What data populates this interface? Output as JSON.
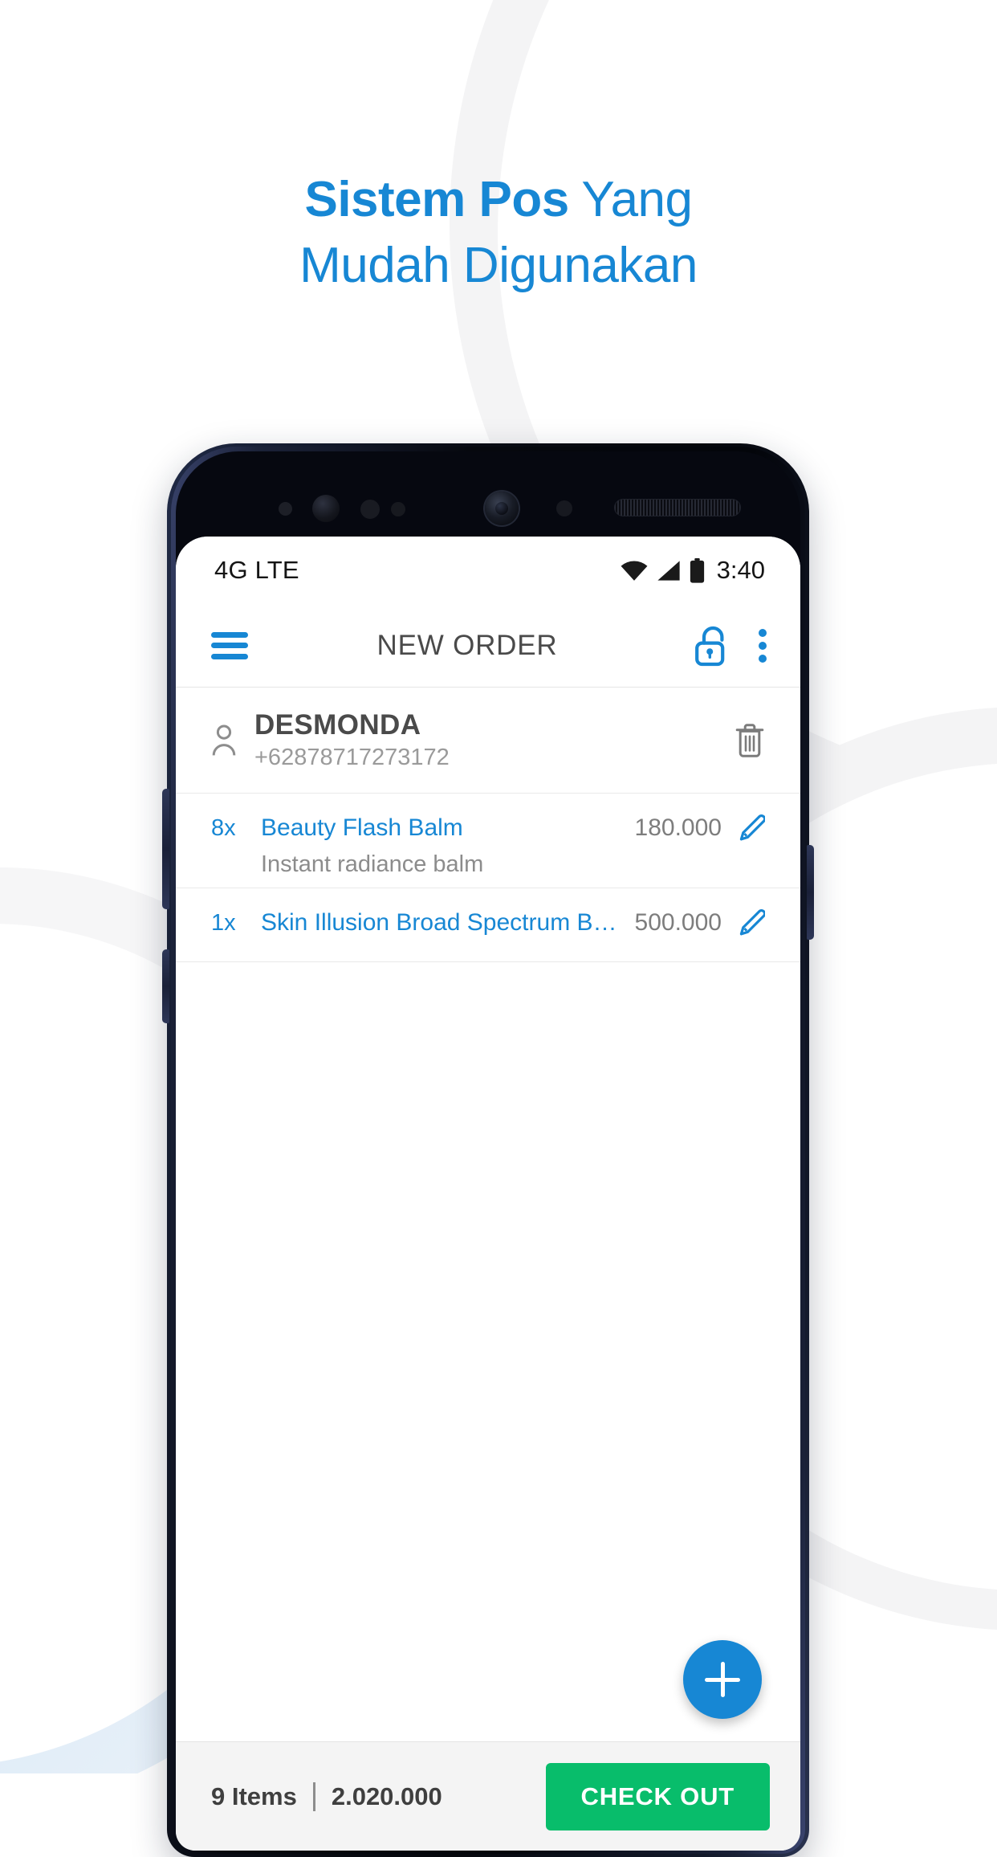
{
  "promo": {
    "headline_line1_bold": "Sistem Pos",
    "headline_line1_rest": " Yang",
    "headline_line2": "Mudah Digunakan",
    "accent_color": "#1787d4"
  },
  "phone": {
    "status_bar": {
      "network": "4G LTE",
      "time": "3:40",
      "icons": [
        "wifi-icon",
        "signal-icon",
        "battery-icon"
      ]
    },
    "app_bar": {
      "menu_icon": "hamburger-menu-icon",
      "title": "NEW ORDER",
      "lock_icon": "unlocked-padlock-icon",
      "overflow_icon": "kebab-menu-icon"
    },
    "customer": {
      "avatar_icon": "person-icon",
      "name": "DESMONDA",
      "phone": "+62878717273172",
      "delete_icon": "trash-icon"
    },
    "items": [
      {
        "qty": "8x",
        "name": "Beauty Flash Balm",
        "description": "Instant radiance balm",
        "price": "180.000",
        "edit_icon": "pencil-icon"
      },
      {
        "qty": "1x",
        "name": "Skin Illusion Broad Spectrum Bro...",
        "description": "",
        "price": "500.000",
        "edit_icon": "pencil-icon"
      }
    ],
    "fab": {
      "icon": "plus-icon",
      "color": "#1787d4"
    },
    "bottom_bar": {
      "item_count": "9 Items",
      "separator": "|",
      "total": "2.020.000",
      "checkout_label": "CHECK OUT",
      "checkout_color": "#08bd6b"
    }
  }
}
